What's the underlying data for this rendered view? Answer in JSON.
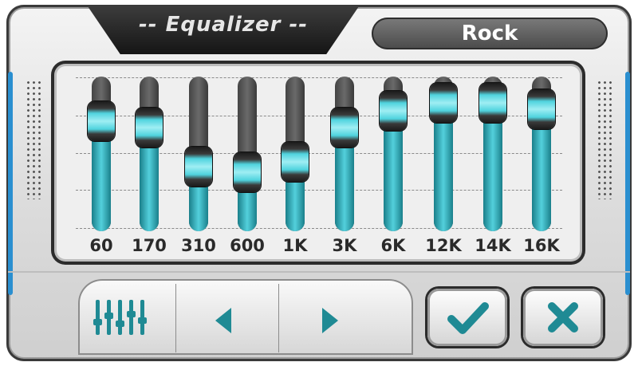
{
  "header": {
    "title": "-- Equalizer --",
    "preset": "Rock"
  },
  "bands": [
    {
      "label": "60",
      "level": 0.71
    },
    {
      "label": "170",
      "level": 0.67
    },
    {
      "label": "310",
      "level": 0.42
    },
    {
      "label": "600",
      "level": 0.38
    },
    {
      "label": "1K",
      "level": 0.45
    },
    {
      "label": "3K",
      "level": 0.67
    },
    {
      "label": "6K",
      "level": 0.78
    },
    {
      "label": "12K",
      "level": 0.83
    },
    {
      "label": "14K",
      "level": 0.83
    },
    {
      "label": "16K",
      "level": 0.79
    }
  ],
  "toolbar": {
    "equalizer_icon": "equalizer-sliders-icon",
    "prev_icon": "triangle-left-icon",
    "next_icon": "triangle-right-icon",
    "confirm_icon": "checkmark-icon",
    "cancel_icon": "x-mark-icon"
  },
  "colors": {
    "accent": "#1f8a94",
    "slider_glow": "#53d0dc",
    "side_stripe": "#2a8fd0"
  }
}
